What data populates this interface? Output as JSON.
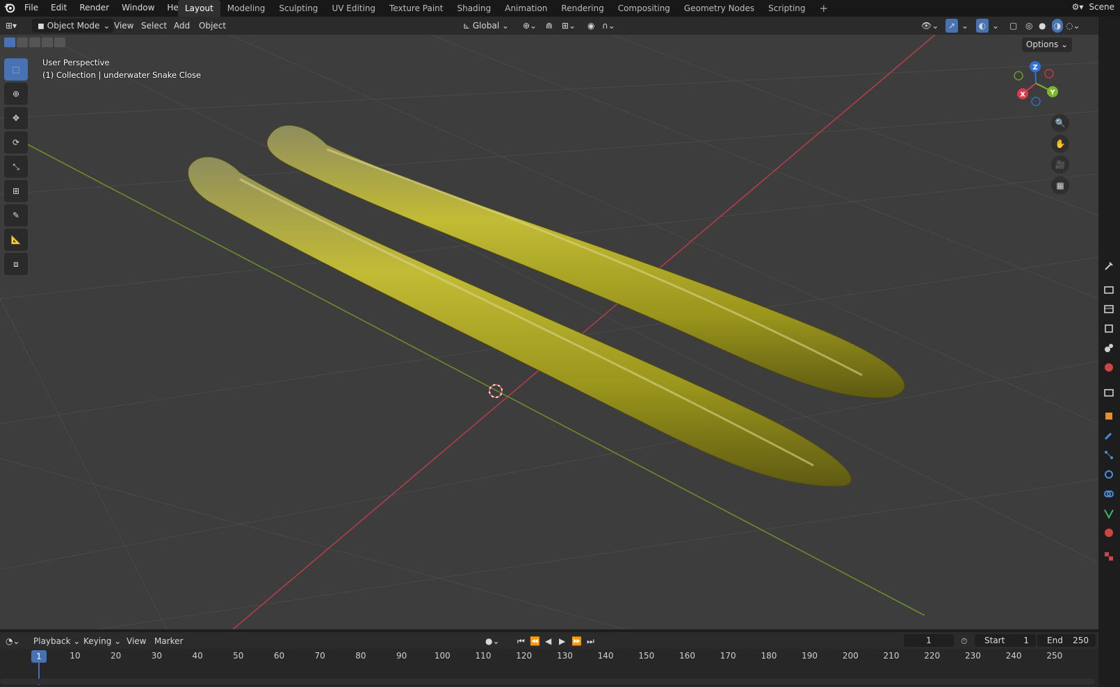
{
  "menu": [
    "File",
    "Edit",
    "Render",
    "Window",
    "Help"
  ],
  "workspaces": [
    "Layout",
    "Modeling",
    "Sculpting",
    "UV Editing",
    "Texture Paint",
    "Shading",
    "Animation",
    "Rendering",
    "Compositing",
    "Geometry Nodes",
    "Scripting"
  ],
  "active_workspace": "Layout",
  "scene_label": "Scene",
  "header": {
    "mode": "Object Mode",
    "view": "View",
    "select": "Select",
    "add": "Add",
    "object": "Object",
    "orientation": "Global"
  },
  "viewport": {
    "perspective": "User Perspective",
    "collection_info": "(1) Collection | underwater Snake Close",
    "options": "Options"
  },
  "gizmo": {
    "x": "X",
    "y": "Y",
    "z": "Z"
  },
  "timeline": {
    "playback": "Playback",
    "keying": "Keying",
    "view": "View",
    "marker": "Marker",
    "current_frame": "1",
    "start_label": "Start",
    "start_value": "1",
    "end_label": "End",
    "end_value": "250",
    "ruler": [
      "10",
      "20",
      "30",
      "40",
      "50",
      "60",
      "70",
      "80",
      "90",
      "100",
      "110",
      "120",
      "130",
      "140",
      "150",
      "160",
      "170",
      "180",
      "190",
      "200",
      "210",
      "220",
      "230",
      "240",
      "250"
    ],
    "playhead_label": "1"
  },
  "colors": {
    "accent": "#4772b3",
    "x_axis": "#c8404a",
    "y_axis": "#7ea02c",
    "snake": "#b8b224"
  }
}
